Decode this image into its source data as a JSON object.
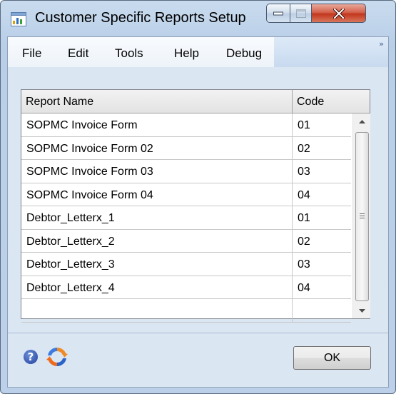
{
  "window": {
    "title": "Customer Specific Reports Setup"
  },
  "menu": {
    "file": "File",
    "edit": "Edit",
    "tools": "Tools",
    "help": "Help",
    "debug": "Debug",
    "overflow": "»"
  },
  "grid": {
    "columns": {
      "name": "Report Name",
      "code": "Code"
    },
    "rows": [
      {
        "name": "SOPMC Invoice Form",
        "code": "01"
      },
      {
        "name": "SOPMC Invoice Form 02",
        "code": "02"
      },
      {
        "name": "SOPMC Invoice Form 03",
        "code": "03"
      },
      {
        "name": "SOPMC Invoice Form 04",
        "code": "04"
      },
      {
        "name": "Debtor_Letterx_1",
        "code": "01"
      },
      {
        "name": "Debtor_Letterx_2",
        "code": "02"
      },
      {
        "name": "Debtor_Letterx_3",
        "code": "03"
      },
      {
        "name": "Debtor_Letterx_4",
        "code": "04"
      },
      {
        "name": "",
        "code": ""
      }
    ]
  },
  "footer": {
    "help_glyph": "?",
    "ok_label": "OK"
  },
  "icons": {
    "app": "report-window-icon",
    "help": "help-icon",
    "refresh": "refresh-icon"
  },
  "colors": {
    "frame": "#bcd1e9",
    "close": "#c2371d",
    "client": "#dbe6f3"
  }
}
